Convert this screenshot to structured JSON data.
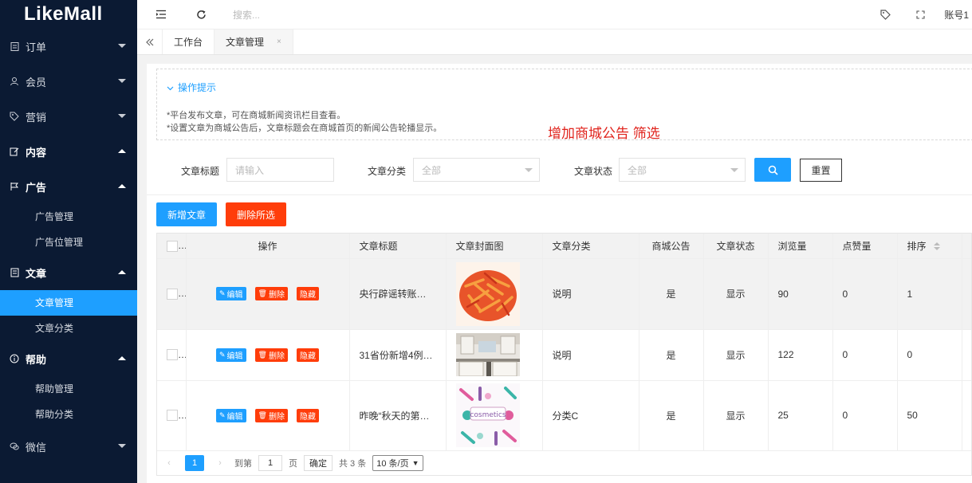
{
  "logo": "LikeMall",
  "sidebar": {
    "menus": [
      {
        "label": "订单",
        "icon": "clipboard-icon",
        "open": false
      },
      {
        "label": "会员",
        "icon": "user-icon",
        "open": false
      },
      {
        "label": "营销",
        "icon": "tag-icon",
        "open": false
      },
      {
        "label": "内容",
        "icon": "edit-icon",
        "open": true
      },
      {
        "label": "广告",
        "icon": "flag-icon",
        "open": true
      },
      {
        "label": "文章",
        "icon": "document-icon",
        "open": true
      },
      {
        "label": "帮助",
        "icon": "info-icon",
        "open": true
      },
      {
        "label": "微信",
        "icon": "wechat-icon",
        "open": false
      }
    ],
    "ad_subs": [
      "广告管理",
      "广告位管理"
    ],
    "article_subs": [
      "文章管理",
      "文章分类"
    ],
    "help_subs": [
      "帮助管理",
      "帮助分类"
    ]
  },
  "topbar": {
    "search_placeholder": "搜索...",
    "account": "账号1"
  },
  "tabs": [
    {
      "label": "工作台"
    },
    {
      "label": "文章管理",
      "close": "×"
    }
  ],
  "tips": {
    "title": "操作提示",
    "lines": [
      "*平台发布文章，可在商城新闻资讯栏目查看。",
      "*设置文章为商城公告后，文章标题会在商城首页的新闻公告轮播显示。"
    ],
    "annotation": "增加商城公告 筛选"
  },
  "filters": {
    "title_label": "文章标题",
    "title_placeholder": "请输入",
    "category_label": "文章分类",
    "category_value": "全部",
    "status_label": "文章状态",
    "status_value": "全部",
    "reset": "重置"
  },
  "actions": {
    "add": "新增文章",
    "delete_selected": "删除所选"
  },
  "table": {
    "headers": [
      "操作",
      "文章标题",
      "文章封面图",
      "文章分类",
      "商城公告",
      "文章状态",
      "浏览量",
      "点赞量",
      "排序"
    ],
    "op_labels": {
      "edit": "编辑",
      "delete": "删除",
      "hide": "隐藏"
    },
    "rows": [
      {
        "title": "央行辟谣转账超1…",
        "cover": "pasta-image",
        "category": "说明",
        "notice": "是",
        "status": "显示",
        "views": "90",
        "likes": "0",
        "sort": "1"
      },
      {
        "title": "31省份新增4例…",
        "cover": "kitchen-image",
        "category": "说明",
        "notice": "是",
        "status": "显示",
        "views": "122",
        "likes": "0",
        "sort": "0"
      },
      {
        "title": "昨晚“秋天的第一…",
        "cover": "cosmetics-image",
        "category": "分类C",
        "notice": "是",
        "status": "显示",
        "views": "25",
        "likes": "0",
        "sort": "50"
      }
    ]
  },
  "pager": {
    "current": "1",
    "goto_prefix": "到第",
    "goto_value": "1",
    "goto_suffix": "页",
    "confirm": "确定",
    "total": "共 3 条",
    "page_size": "10 条/页"
  }
}
